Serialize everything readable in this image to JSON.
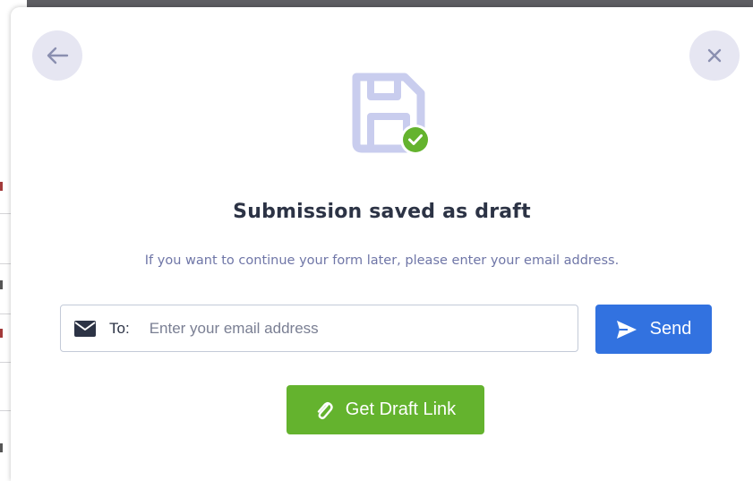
{
  "modal": {
    "title": "Submission saved as draft",
    "subtitle": "If you want to continue your form later, please enter your email address.",
    "back_icon": "arrow-left-icon",
    "close_icon": "close-icon",
    "hero_icon": "floppy-disk-check-icon"
  },
  "email_form": {
    "to_label": "To:",
    "placeholder": "Enter your email address",
    "value": "",
    "mail_icon": "envelope-icon",
    "send_label": "Send",
    "send_icon": "paper-plane-icon"
  },
  "draft_link": {
    "label": "Get Draft Link",
    "icon": "paperclip-icon"
  },
  "colors": {
    "send_button": "#3272e0",
    "draft_button": "#64b32e",
    "title_text": "#2c3345",
    "subtitle_text": "#6f76a7",
    "icon_tint": "#c9cdee",
    "check_badge": "#64b32e"
  }
}
